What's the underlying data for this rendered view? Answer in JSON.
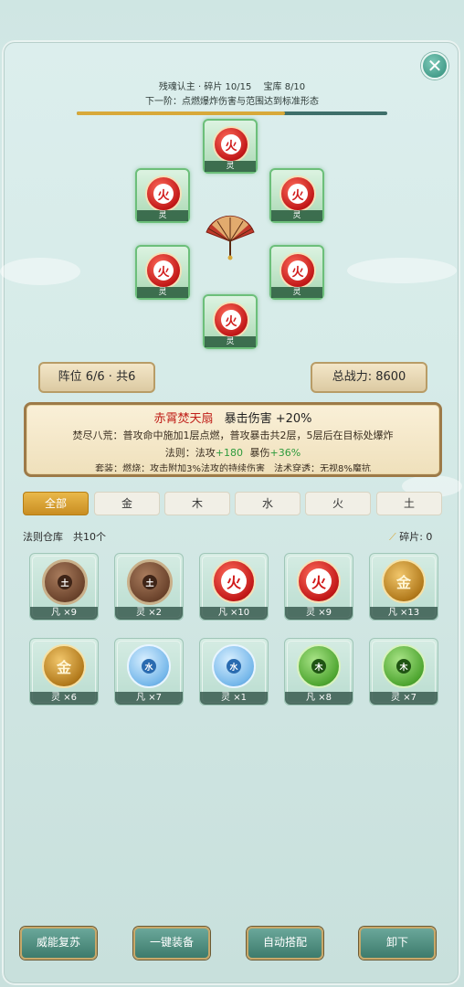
{
  "header": {
    "line1": "残魂认主 · 碎片 10/15　 宝库 8/10",
    "line2": "下一阶：点燃爆炸伤害与范围达到标准形态",
    "progress_fraction": 0.67
  },
  "formation_slots": [
    {
      "element": "火",
      "grade": "灵"
    },
    {
      "element": "火",
      "grade": "灵"
    },
    {
      "element": "火",
      "grade": "灵"
    },
    {
      "element": "火",
      "grade": "灵"
    },
    {
      "element": "火",
      "grade": "灵"
    },
    {
      "element": "火",
      "grade": "灵"
    }
  ],
  "stats": {
    "formation": "阵位 6/6 · 共6",
    "power": "总战力: 8600"
  },
  "info": {
    "name": "赤霄焚天扇",
    "effect": "暴击伤害 +20%",
    "desc": "焚尽八荒：普攻命中施加1层点燃，普攻暴击共2层，5层后在目标处爆炸",
    "law_prefix": "法则：法攻",
    "law_atk": "+180",
    "law_mid": "暴伤",
    "law_crit": "+36%",
    "set": "套装：燃烧：攻击附加3%法攻的持续伤害　法术穿透：无视8%魔抗"
  },
  "tabs": [
    "全部",
    "金",
    "木",
    "水",
    "火",
    "土"
  ],
  "warehouse": {
    "title": "法则仓库　共10个",
    "shards": "碎片: 0"
  },
  "cards": [
    {
      "element": "土",
      "label": "凡 ×9",
      "type": "earth"
    },
    {
      "element": "土",
      "label": "灵 ×2",
      "type": "earth"
    },
    {
      "element": "火",
      "label": "凡 ×10",
      "type": "fire"
    },
    {
      "element": "火",
      "label": "灵 ×9",
      "type": "fire"
    },
    {
      "element": "金",
      "label": "凡 ×13",
      "type": "metal"
    },
    {
      "element": "金",
      "label": "灵 ×6",
      "type": "metal"
    },
    {
      "element": "水",
      "label": "凡 ×7",
      "type": "water"
    },
    {
      "element": "水",
      "label": "灵 ×1",
      "type": "water"
    },
    {
      "element": "木",
      "label": "凡 ×8",
      "type": "wood"
    },
    {
      "element": "木",
      "label": "灵 ×7",
      "type": "wood"
    }
  ],
  "buttons": [
    "威能复苏",
    "一键装备",
    "自动搭配",
    "卸下"
  ],
  "colors": {
    "accent_gold": "#d8a93a",
    "fire_red": "#c21818",
    "panel_bg": "#d6ebe8"
  }
}
